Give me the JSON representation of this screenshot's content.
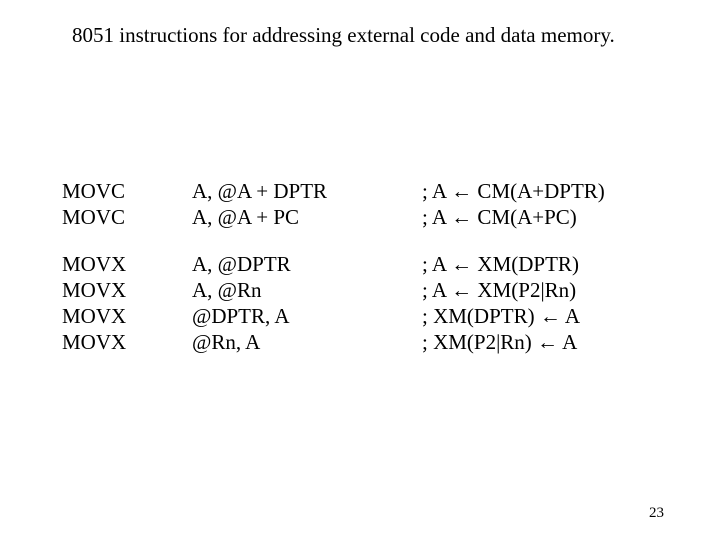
{
  "title": "8051 instructions for addressing external code and data memory.",
  "page_number": "23",
  "groups": [
    {
      "rows": [
        {
          "mnemonic": "MOVC",
          "operands": "A, @A + DPTR",
          "comment": "; A ← CM(A+DPTR)"
        },
        {
          "mnemonic": "MOVC",
          "operands": "A, @A + PC",
          "comment": "; A ← CM(A+PC)"
        }
      ]
    },
    {
      "rows": [
        {
          "mnemonic": "MOVX",
          "operands": "A, @DPTR",
          "comment": "; A ← XM(DPTR)"
        },
        {
          "mnemonic": "MOVX",
          "operands": "A, @Rn",
          "comment": "; A ← XM(P2|Rn)"
        },
        {
          "mnemonic": "MOVX",
          "operands": "@DPTR, A",
          "comment": "; XM(DPTR) ← A"
        },
        {
          "mnemonic": "MOVX",
          "operands": "@Rn, A",
          "comment": "; XM(P2|Rn) ← A"
        }
      ]
    }
  ]
}
